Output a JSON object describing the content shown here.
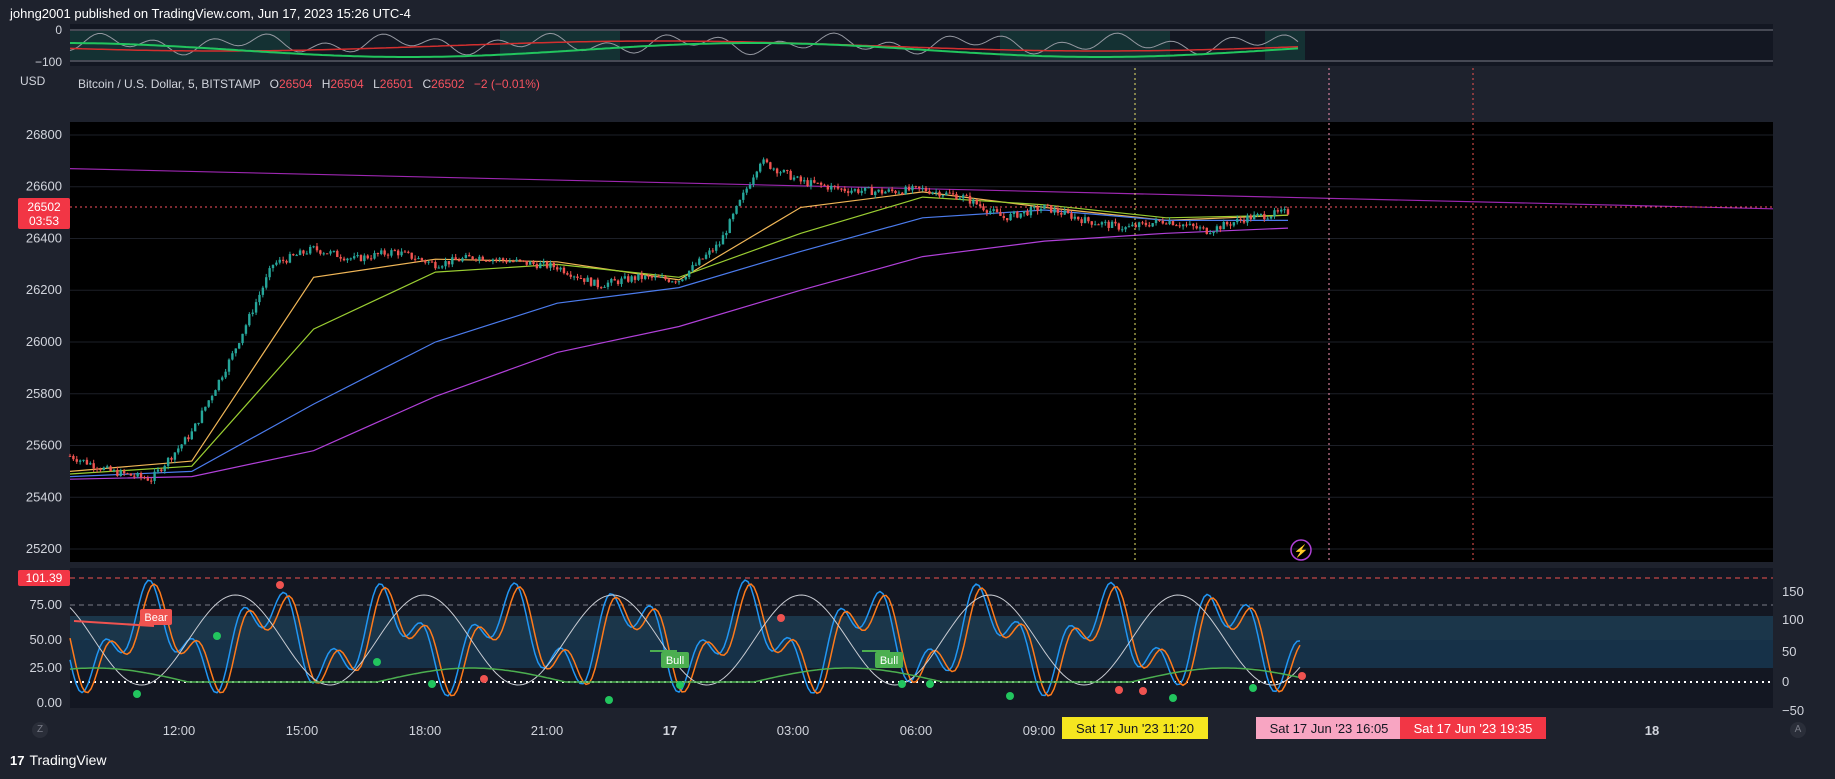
{
  "header": {
    "publisher": "johng2001 published on TradingView.com, Jun 17, 2023 15:26 UTC-4",
    "currency": "USD"
  },
  "legend": {
    "symbol": "Bitcoin / U.S. Dollar, 5, BITSTAMP",
    "open_key": "O",
    "open": "26504",
    "high_key": "H",
    "high": "26504",
    "low_key": "L",
    "low": "26501",
    "close_key": "C",
    "close": "26502",
    "change": "−2 (−0.01%)"
  },
  "price_axis": {
    "ticks": [
      "26800",
      "26600",
      "26400",
      "26200",
      "26000",
      "25800",
      "25600",
      "25400",
      "25200"
    ],
    "last_price": "26502",
    "countdown": "03:53"
  },
  "top_indicator": {
    "ticks": [
      "0",
      "−100"
    ]
  },
  "oscillator": {
    "left_ticks": [
      "75.00",
      "50.00",
      "25.00",
      "0.00"
    ],
    "left_marker": "101.39",
    "right_ticks": [
      "150",
      "100",
      "50",
      "0",
      "−50"
    ],
    "labels": [
      "Bear",
      "Bull",
      "Bull"
    ]
  },
  "time_axis": {
    "ticks": [
      "12:00",
      "15:00",
      "18:00",
      "21:00",
      "17",
      "03:00",
      "06:00",
      "09:00",
      "18"
    ],
    "markers": [
      "Sat 17 Jun '23   11:20",
      "Sat 17 Jun '23   16:05",
      "Sat 17 Jun '23   19:35"
    ]
  },
  "footer": {
    "brand": "TradingView",
    "logo": "17",
    "corner_left": "Z",
    "corner_right": "A"
  },
  "colors": {
    "up": "#26a69a",
    "down": "#ef5350",
    "ema_fast": "#f0b657",
    "ema_mid": "#9acd32",
    "ema_slow": "#4b7bec",
    "ema_long": "#b040d8",
    "trendline": "#9c27b0"
  },
  "chart_data": {
    "type": "line",
    "xlabel": "",
    "ylabel": "",
    "ylim": [
      25150,
      26850
    ],
    "series": [
      {
        "x": [
          "09:00",
          "10:00",
          "11:00",
          "12:00",
          "13:00",
          "14:00",
          "15:00",
          "16:00",
          "17:00",
          "18:00",
          "19:00",
          "20:00",
          "21:00",
          "22:00",
          "23:00",
          "00:00",
          "01:00",
          "02:00",
          "03:00",
          "04:00",
          "05:00",
          "06:00",
          "07:00",
          "08:00",
          "09:00",
          "10:00",
          "11:00",
          "12:00",
          "13:00",
          "14:00",
          "15:00"
        ],
        "y": [
          25560,
          25500,
          25470,
          25650,
          25950,
          26300,
          26360,
          26320,
          26350,
          26300,
          26330,
          26310,
          26290,
          26220,
          26250,
          26240,
          26380,
          26700,
          26620,
          26590,
          26580,
          26590,
          26560,
          26480,
          26520,
          26470,
          26440,
          26470,
          26430,
          26480,
          26502
        ]
      },
      {
        "x": [
          "09:00",
          "12:00",
          "15:00",
          "18:00",
          "21:00",
          "00:00",
          "03:00",
          "06:00",
          "09:00",
          "12:00",
          "15:00"
        ],
        "y": [
          25500,
          25540,
          26250,
          26320,
          26310,
          26240,
          26520,
          26580,
          26520,
          26470,
          26490
        ]
      },
      {
        "x": [
          "09:00",
          "12:00",
          "15:00",
          "18:00",
          "21:00",
          "00:00",
          "03:00",
          "06:00",
          "09:00",
          "12:00",
          "15:00"
        ],
        "y": [
          25490,
          25520,
          26050,
          26270,
          26300,
          26250,
          26420,
          26560,
          26530,
          26480,
          26490
        ]
      },
      {
        "x": [
          "09:00",
          "12:00",
          "15:00",
          "18:00",
          "21:00",
          "00:00",
          "03:00",
          "06:00",
          "09:00",
          "12:00",
          "15:00"
        ],
        "y": [
          25480,
          25500,
          25760,
          26000,
          26150,
          26210,
          26350,
          26480,
          26510,
          26470,
          26470
        ]
      },
      {
        "x": [
          "09:00",
          "12:00",
          "15:00",
          "18:00",
          "21:00",
          "00:00",
          "03:00",
          "06:00",
          "09:00",
          "12:00",
          "15:00"
        ],
        "y": [
          25470,
          25480,
          25580,
          25790,
          25960,
          26060,
          26200,
          26330,
          26390,
          26420,
          26440
        ]
      },
      {
        "x": [
          "09:00",
          "15:00"
        ],
        "y": [
          26670,
          26530
        ]
      }
    ]
  }
}
